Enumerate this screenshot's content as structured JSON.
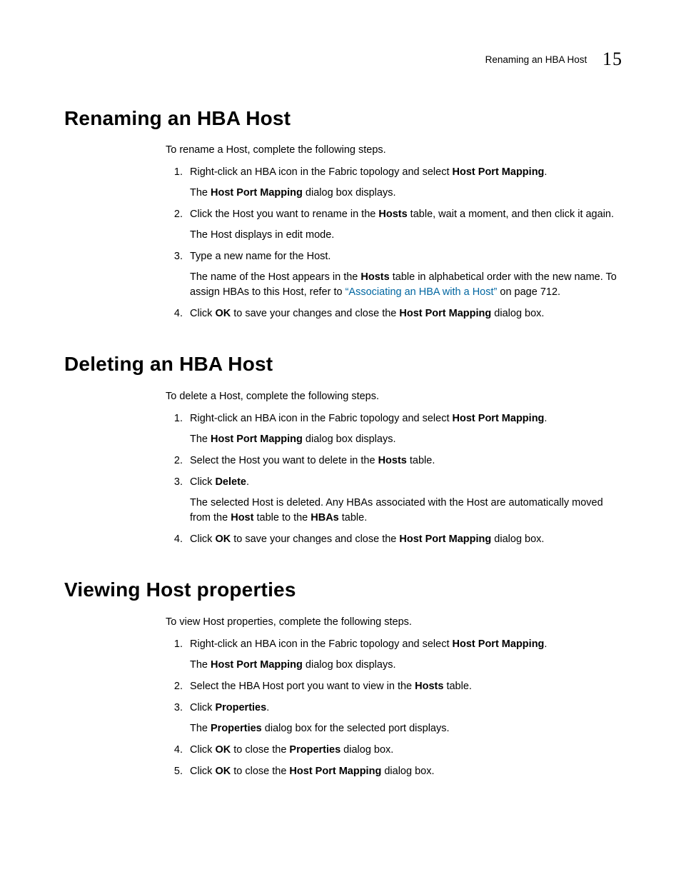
{
  "header": {
    "running_title": "Renaming an HBA Host",
    "chapter_number": "15"
  },
  "sections": {
    "renaming": {
      "title": "Renaming an HBA Host",
      "intro": "To rename a Host, complete the following steps.",
      "s1_a": "Right-click an HBA icon in the Fabric topology and select ",
      "s1_b": "Host Port Mapping",
      "s1_c": ".",
      "s1_r_a": "The ",
      "s1_r_b": "Host Port Mapping",
      "s1_r_c": " dialog box displays.",
      "s2_a": "Click the Host you want to rename in the ",
      "s2_b": "Hosts",
      "s2_c": " table, wait a moment, and then click it again.",
      "s2_r": "The Host displays in edit mode.",
      "s3": "Type a new name for the Host.",
      "s3_r_a": "The name of the Host appears in the ",
      "s3_r_b": "Hosts",
      "s3_r_c": " table in alphabetical order with the new name. To assign HBAs to this Host, refer to ",
      "s3_r_link": "“Associating an HBA with a Host”",
      "s3_r_d": " on page 712.",
      "s4_a": "Click ",
      "s4_b": "OK",
      "s4_c": " to save your changes and close the ",
      "s4_d": "Host Port Mapping",
      "s4_e": " dialog box."
    },
    "deleting": {
      "title": "Deleting an HBA Host",
      "intro": "To delete a Host, complete the following steps.",
      "s1_a": "Right-click an HBA icon in the Fabric topology and select ",
      "s1_b": "Host Port Mapping",
      "s1_c": ".",
      "s1_r_a": "The ",
      "s1_r_b": "Host Port Mapping",
      "s1_r_c": " dialog box displays.",
      "s2_a": "Select the Host you want to delete in the ",
      "s2_b": "Hosts",
      "s2_c": " table.",
      "s3_a": "Click ",
      "s3_b": "Delete",
      "s3_c": ".",
      "s3_r_a": "The selected Host is deleted. Any HBAs associated with the Host are automatically moved from the ",
      "s3_r_b": "Host",
      "s3_r_c": " table to the ",
      "s3_r_d": "HBAs",
      "s3_r_e": " table.",
      "s4_a": "Click ",
      "s4_b": "OK",
      "s4_c": " to save your changes and close the ",
      "s4_d": "Host Port Mapping",
      "s4_e": " dialog box."
    },
    "viewing": {
      "title": "Viewing Host properties",
      "intro": "To view Host properties, complete the following steps.",
      "s1_a": "Right-click an HBA icon in the Fabric topology and select ",
      "s1_b": "Host Port Mapping",
      "s1_c": ".",
      "s1_r_a": "The ",
      "s1_r_b": "Host Port Mapping",
      "s1_r_c": " dialog box displays.",
      "s2_a": "Select the HBA Host port you want to view in the ",
      "s2_b": "Hosts",
      "s2_c": " table.",
      "s3_a": "Click ",
      "s3_b": "Properties",
      "s3_c": ".",
      "s3_r_a": "The ",
      "s3_r_b": "Properties",
      "s3_r_c": " dialog box for the selected port displays.",
      "s4_a": "Click ",
      "s4_b": "OK",
      "s4_c": " to close the ",
      "s4_d": "Properties",
      "s4_e": " dialog box.",
      "s5_a": "Click ",
      "s5_b": "OK",
      "s5_c": " to close the ",
      "s5_d": "Host Port Mapping",
      "s5_e": " dialog box."
    }
  }
}
